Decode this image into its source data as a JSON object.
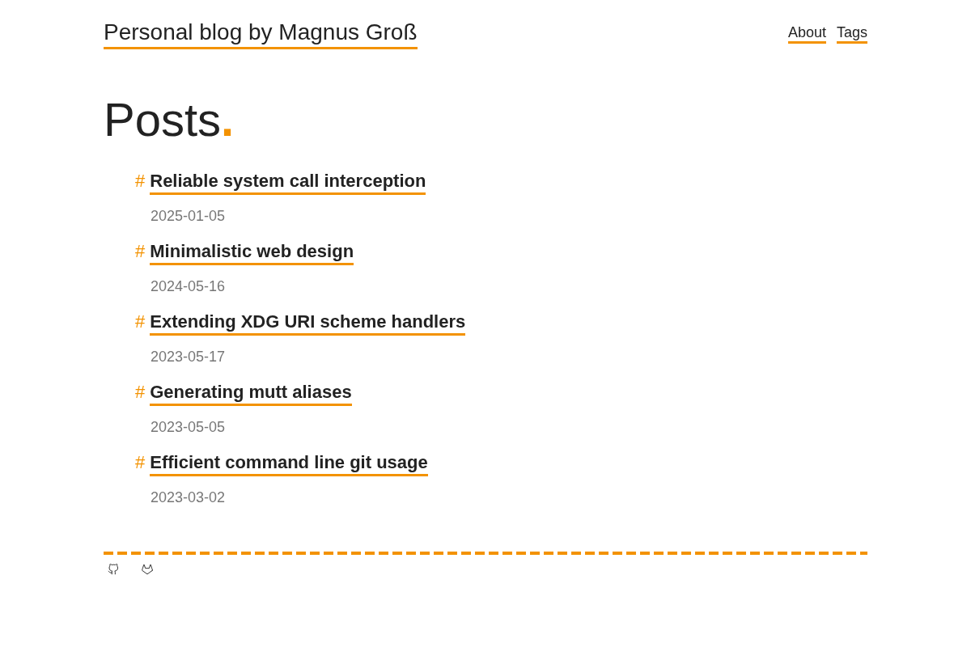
{
  "site_title": "Personal blog by Magnus Groß",
  "nav": [
    {
      "label": "About"
    },
    {
      "label": "Tags"
    }
  ],
  "heading": {
    "text": "Posts",
    "mark": "."
  },
  "posts": [
    {
      "marker": "#",
      "title": "Reliable system call interception",
      "date": "2025-01-05"
    },
    {
      "marker": "#",
      "title": "Minimalistic web design",
      "date": "2024-05-16"
    },
    {
      "marker": "#",
      "title": "Extending XDG URI scheme handlers",
      "date": "2023-05-17"
    },
    {
      "marker": "#",
      "title": "Generating mutt aliases",
      "date": "2023-05-05"
    },
    {
      "marker": "#",
      "title": "Efficient command line git usage",
      "date": "2023-03-02"
    }
  ],
  "footer": {
    "links": [
      {
        "kind": "github"
      },
      {
        "kind": "gitlab"
      }
    ]
  }
}
